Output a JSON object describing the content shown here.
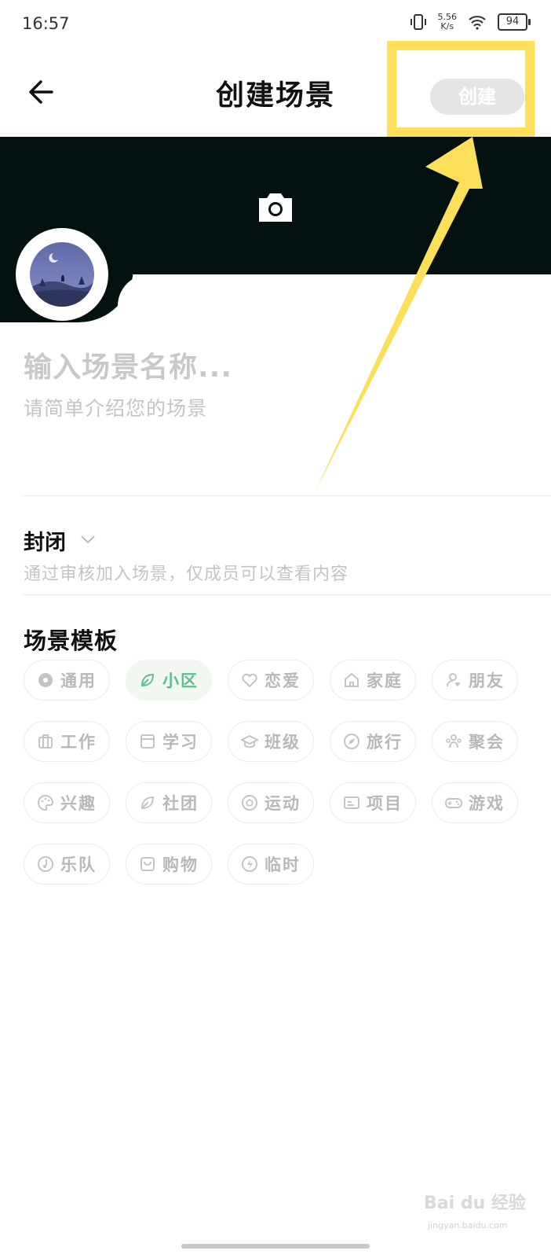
{
  "status_bar": {
    "time": "16:57",
    "net_speed_value": "5.56",
    "net_speed_unit": "K/s",
    "battery": "94"
  },
  "header": {
    "title": "创建场景",
    "create_label": "创建"
  },
  "scene": {
    "name_placeholder": "输入场景名称...",
    "desc_placeholder": "请简单介绍您的场景"
  },
  "privacy": {
    "label": "封闭",
    "description": "通过审核加入场景，仅成员可以查看内容"
  },
  "templates": {
    "title": "场景模板",
    "items": [
      {
        "label": "通用",
        "icon": "flower-icon",
        "selected": false
      },
      {
        "label": "小区",
        "icon": "leaf-icon",
        "selected": true
      },
      {
        "label": "恋爱",
        "icon": "hearts-icon",
        "selected": false
      },
      {
        "label": "家庭",
        "icon": "home-icon",
        "selected": false
      },
      {
        "label": "朋友",
        "icon": "friend-icon",
        "selected": false
      },
      {
        "label": "工作",
        "icon": "briefcase-icon",
        "selected": false
      },
      {
        "label": "学习",
        "icon": "book-icon",
        "selected": false
      },
      {
        "label": "班级",
        "icon": "graduation-cap-icon",
        "selected": false
      },
      {
        "label": "旅行",
        "icon": "compass-icon",
        "selected": false
      },
      {
        "label": "聚会",
        "icon": "group-icon",
        "selected": false
      },
      {
        "label": "兴趣",
        "icon": "palette-icon",
        "selected": false
      },
      {
        "label": "社团",
        "icon": "leaf-outline-icon",
        "selected": false
      },
      {
        "label": "运动",
        "icon": "ball-icon",
        "selected": false
      },
      {
        "label": "项目",
        "icon": "id-card-icon",
        "selected": false
      },
      {
        "label": "游戏",
        "icon": "gamepad-icon",
        "selected": false
      },
      {
        "label": "乐队",
        "icon": "music-icon",
        "selected": false
      },
      {
        "label": "购物",
        "icon": "shopping-bag-icon",
        "selected": false
      },
      {
        "label": "临时",
        "icon": "lightning-icon",
        "selected": false
      }
    ]
  },
  "watermark": {
    "text": "Bai du 经验",
    "sub": "jingyan.baidu.com"
  },
  "colors": {
    "cover": "#041111",
    "accent_green": "#5bbf8a",
    "highlight_yellow": "#fedf5a",
    "chip_text": "#b8b8b8"
  }
}
